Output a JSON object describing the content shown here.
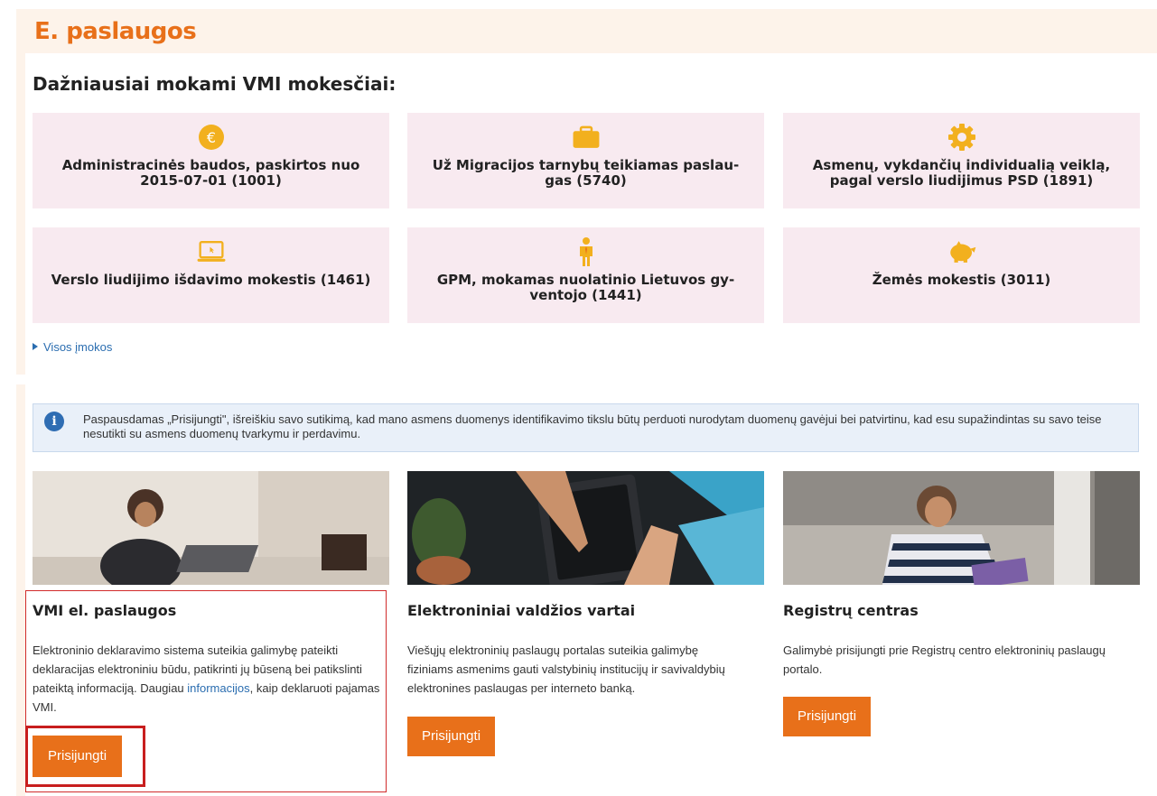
{
  "header": {
    "title": "E. paslaugos"
  },
  "payments": {
    "section_title": "Dažniausiai mokami VMI mokesčiai:",
    "tiles": [
      {
        "icon": "euro-coin-icon",
        "label": "Administracinės baudos, paskirtos nuo 2015-07-01 (1001)"
      },
      {
        "icon": "briefcase-icon",
        "label": "Už Migracijos tarnybų teikiamas paslau-gas (5740)"
      },
      {
        "icon": "gear-icon",
        "label": "Asmenų, vykdančių individualią veiklą, pagal verslo liudijimus PSD (1891)"
      },
      {
        "icon": "laptop-icon",
        "label": "Verslo liudijimo išdavimo mokestis (1461)"
      },
      {
        "icon": "person-icon",
        "label": "GPM, mokamas nuolatinio Lietuvos gy-ventojo (1441)"
      },
      {
        "icon": "piggy-bank-icon",
        "label": "Žemės mokestis (3011)"
      }
    ],
    "all_link": "Visos įmokos"
  },
  "notice": {
    "icon": "info-icon",
    "text": "Paspausdamas „Prisijungti\", išreiškiu savo sutikimą, kad mano asmens duomenys identifikavimo tikslu būtų perduoti nurodytam duomenų gavėjui bei patvirtinu, kad esu supažindintas su savo teise nesutikti su asmens duomenų tvarkymu ir perdavimu."
  },
  "cards": [
    {
      "title": "VMI el. paslaugos",
      "desc_before": "Elektroninio deklaravimo sistema suteikia galimybę pateikti deklaracijas elektroniniu būdu, patikrinti jų būseną bei patikslinti pateiktą informaciją. Daugiau ",
      "desc_link": "informacijos",
      "desc_after": ", kaip deklaruoti pajamas VMI.",
      "button": "Prisijungti"
    },
    {
      "title": "Elektroniniai valdžios vartai",
      "desc": "Viešųjų elektroninių paslaugų portalas suteikia galimybę fiziniams asmenims gauti valstybinių institucijų ir savivaldybių elektronines paslaugas per interneto banką.",
      "button": "Prisijungti"
    },
    {
      "title": "Registrų centras",
      "desc": "Galimybė prisijungti prie Registrų centro elektroninių paslaugų portalo.",
      "button": "Prisijungti"
    }
  ],
  "colors": {
    "accent": "#e8701a",
    "tile_bg": "#f8eaf0",
    "panel_bg": "#fdf3ea",
    "highlight": "#c81e1e",
    "link": "#2a6db0"
  }
}
